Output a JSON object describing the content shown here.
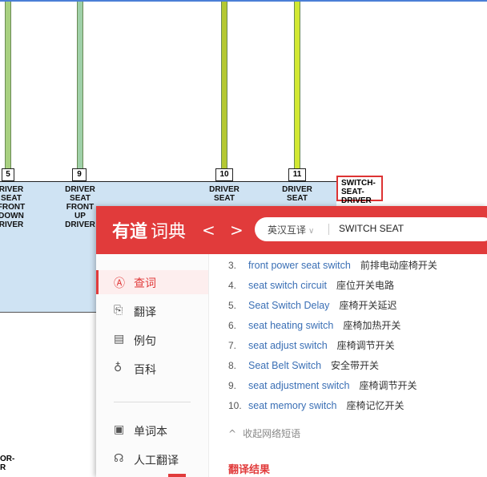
{
  "diagram": {
    "pins": [
      "5",
      "9",
      "10",
      "11"
    ],
    "labels": [
      "RIVER\nSEAT\nFRONT\nDOWN\nRIVER",
      "DRIVER\nSEAT\nFRONT\nUP\nDRIVER",
      "DRIVER\nSEAT",
      "DRIVER\nSEAT"
    ],
    "switch_label": "SWITCH-\nSEAT-\nDRIVER",
    "bottom_label": "OR-\nR",
    "wire_colors": [
      "#a8d080",
      "#9fd0a8",
      "#b4c832",
      "#d2e832"
    ]
  },
  "youdao": {
    "logo": "有道",
    "logo_sub": "词典",
    "nav_back": "<",
    "nav_forward": ">",
    "lang": "英汉互译",
    "query": "SWITCH SEAT",
    "sidebar": [
      {
        "icon": "Ⓐ",
        "label": "查词"
      },
      {
        "icon": "⎘",
        "label": "翻译"
      },
      {
        "icon": "▤",
        "label": "例句"
      },
      {
        "icon": "♁",
        "label": "百科"
      },
      {
        "icon": "▣",
        "label": "单词本"
      },
      {
        "icon": "☊",
        "label": "人工翻译"
      }
    ],
    "phrases": [
      {
        "num": "3.",
        "en": "front power seat switch",
        "zh": "前排电动座椅开关"
      },
      {
        "num": "4.",
        "en": "seat switch circuit",
        "zh": "座位开关电路"
      },
      {
        "num": "5.",
        "en": "Seat Switch Delay",
        "zh": "座椅开关延迟"
      },
      {
        "num": "6.",
        "en": "seat heating switch",
        "zh": "座椅加热开关"
      },
      {
        "num": "7.",
        "en": "seat adjust switch",
        "zh": "座椅调节开关"
      },
      {
        "num": "8.",
        "en": "Seat Belt Switch",
        "zh": "安全带开关"
      },
      {
        "num": "9.",
        "en": "seat adjustment switch",
        "zh": "座椅调节开关"
      },
      {
        "num": "10.",
        "en": "seat memory switch",
        "zh": "座椅记忆开关"
      }
    ],
    "collect": "收起网络短语",
    "collect_icon": "^",
    "translate_result": "翻译结果",
    "accent": "#e13b3b"
  }
}
